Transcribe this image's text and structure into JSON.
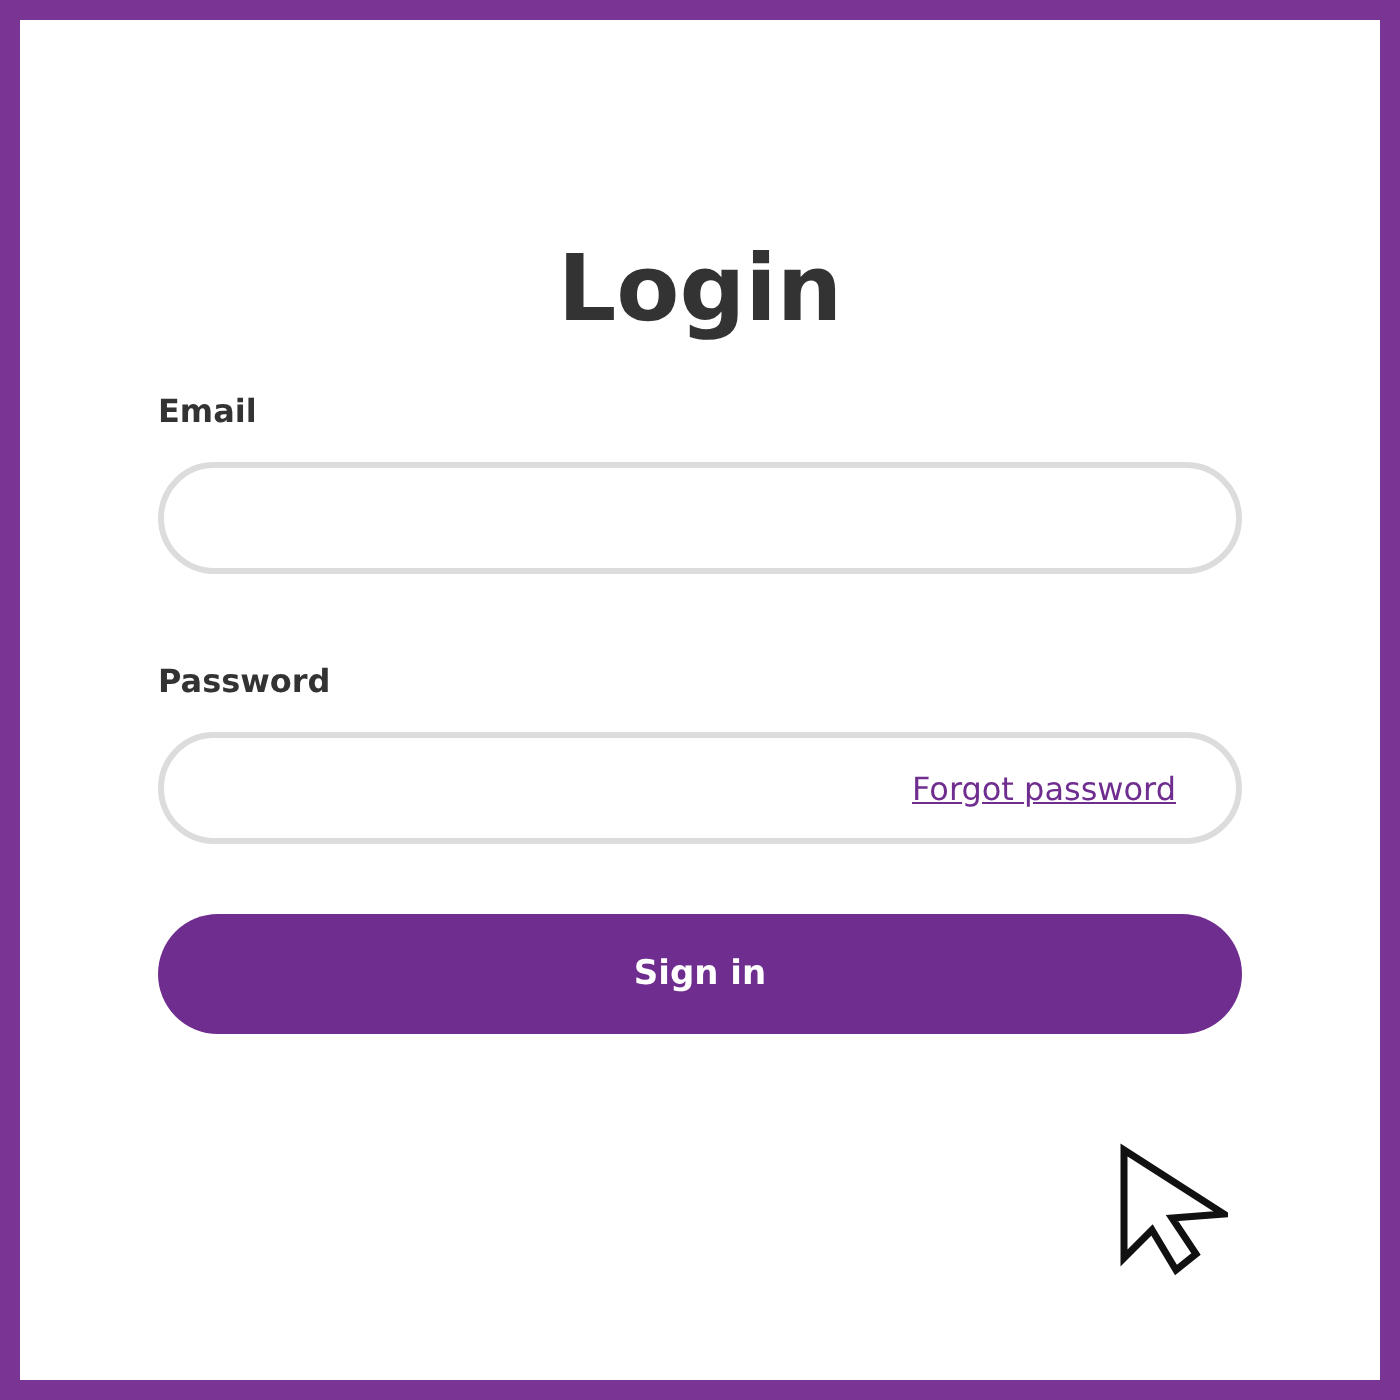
{
  "title": "Login",
  "fields": [
    {
      "label": "Email"
    },
    {
      "label": "Password",
      "link": "Forgot password"
    }
  ],
  "button": "Sign in"
}
